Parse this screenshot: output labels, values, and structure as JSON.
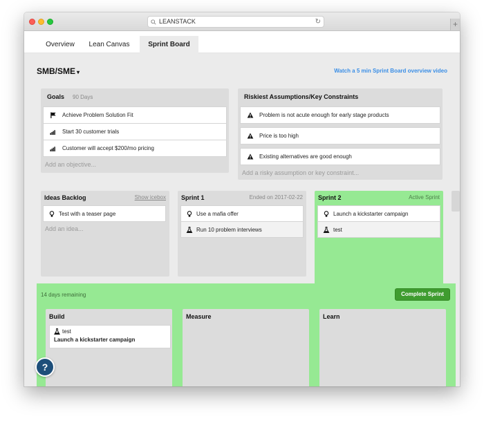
{
  "browser": {
    "url": "LEANSTACK",
    "reload_icon": "reload-icon",
    "new_tab_label": "+"
  },
  "tabs": [
    {
      "label": "Overview",
      "active": false
    },
    {
      "label": "Lean Canvas",
      "active": false
    },
    {
      "label": "Sprint Board",
      "active": true
    }
  ],
  "header": {
    "org_title": "SMB/SME",
    "caret": "▾",
    "video_link": "Watch a 5 min Sprint Board overview video"
  },
  "goals": {
    "title": "Goals",
    "subtitle": "90 Days",
    "items": [
      {
        "label": "Achieve Problem Solution Fit",
        "icon": "flag-icon"
      },
      {
        "label": "Start 30 customer trials",
        "icon": "signal-bars-icon"
      },
      {
        "label": "Customer will accept $200/mo pricing",
        "icon": "signal-bars-icon"
      }
    ],
    "add_label": "Add an objective..."
  },
  "risks": {
    "title": "Riskiest Assumptions/Key Constraints",
    "items": [
      {
        "label": "Problem is not acute enough for early stage products",
        "icon": "warning-icon"
      },
      {
        "label": "Price is too high",
        "icon": "warning-icon"
      },
      {
        "label": "Existing alternatives are good enough",
        "icon": "warning-icon"
      }
    ],
    "add_label": "Add a risky assumption or key constraint..."
  },
  "ideas": {
    "title": "Ideas Backlog",
    "action": "Show icebox",
    "items": [
      {
        "label": "Test with a teaser page",
        "icon": "lightbulb-icon"
      }
    ],
    "add_label": "Add an idea..."
  },
  "sprint1": {
    "title": "Sprint 1",
    "status": "Ended on 2017-02-22",
    "items": [
      {
        "label": "Use a mafia offer",
        "icon": "lightbulb-icon"
      },
      {
        "label": "Run 10 problem interviews",
        "icon": "flask-icon"
      }
    ]
  },
  "sprint2": {
    "title": "Sprint 2",
    "status": "Active Sprint",
    "items": [
      {
        "label": "Launch a kickstarter campaign",
        "icon": "lightbulb-icon"
      },
      {
        "label": "test",
        "icon": "flask-icon"
      }
    ]
  },
  "active_sprint": {
    "remaining": "14 days remaining",
    "complete_button": "Complete Sprint",
    "columns": [
      {
        "title": "Build"
      },
      {
        "title": "Measure"
      },
      {
        "title": "Learn"
      }
    ],
    "build_card": {
      "title": "test",
      "subtitle": "Launch a kickstarter campaign",
      "icon": "flask-icon"
    }
  },
  "help_label": "?",
  "colors": {
    "accent_green": "#96e993",
    "button_green": "#3f9c2f",
    "link_blue": "#3a8ee6",
    "help_blue": "#1e4f7a"
  }
}
